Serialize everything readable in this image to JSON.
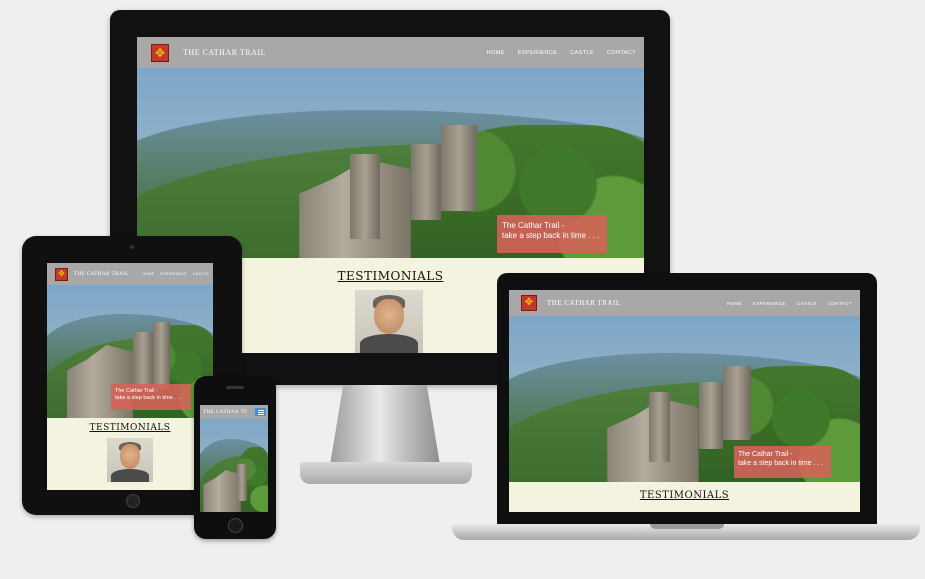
{
  "site": {
    "brand": "THE CATHAR TRAIL",
    "brand_short": "THE CATHAR TF",
    "logo_glyph": "✥",
    "nav": [
      "HOME",
      "EXPERIENCE",
      "CASTLE",
      "CONTACT"
    ],
    "hero_caption_line1": "The Cathar Trail -",
    "hero_caption_line2": "take a step back in time . . .",
    "testimonials_heading": "TESTIMONIALS",
    "menu_icon": "hamburger-menu-icon"
  },
  "colors": {
    "nav_bg": "#a8a8a8",
    "page_bg": "#f4f3df",
    "caption_bg": "#d7625a",
    "logo_bg": "#c0392b",
    "mobile_menu_button": "#3d8fe6"
  }
}
